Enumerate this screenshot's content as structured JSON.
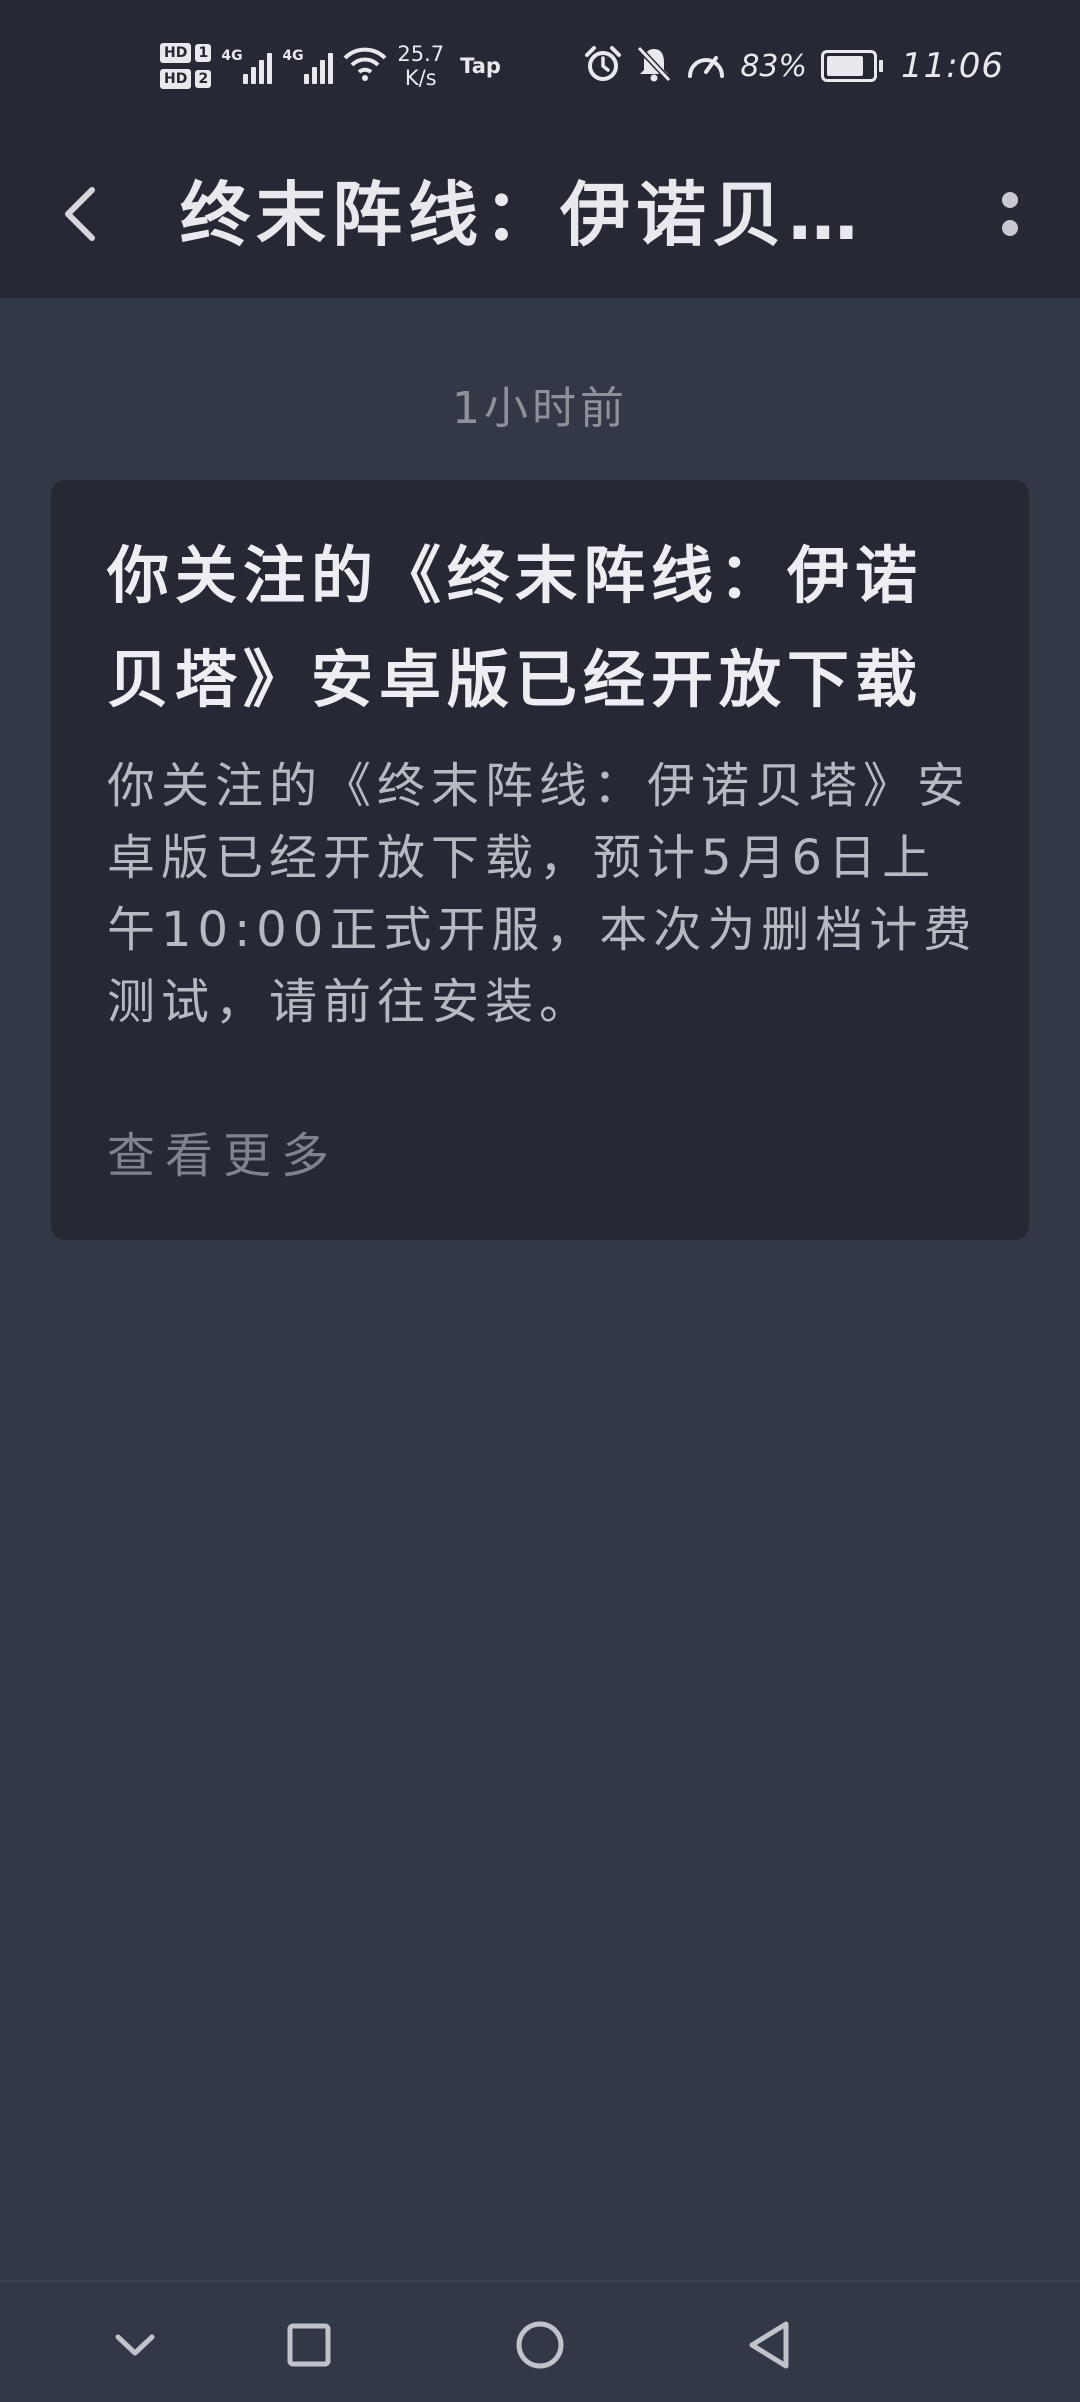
{
  "status_bar": {
    "sim1": "HD",
    "sim1_num": "1",
    "sim2": "HD",
    "sim2_num": "2",
    "net1": "4G",
    "net2": "4G",
    "speed_value": "25.7",
    "speed_unit": "K/s",
    "tap": "Tap",
    "battery_percent": "83%",
    "battery_level": 0.83,
    "time": "11:06"
  },
  "header": {
    "title": "终末阵线：伊诺贝…"
  },
  "message": {
    "timestamp": "1小时前",
    "title": "你关注的《终末阵线：伊诺贝塔》安卓版已经开放下载",
    "body": "你关注的《终末阵线：伊诺贝塔》安卓版已经开放下载，预计5月6日上午10:00正式开服，本次为删档计费测试，请前往安装。",
    "more_label": "查看更多"
  },
  "colors": {
    "background": "#333846",
    "bar": "#262934",
    "card": "#262934",
    "text_primary": "#eceef1",
    "text_secondary": "#b6b9c0",
    "text_muted": "#7f838c"
  }
}
